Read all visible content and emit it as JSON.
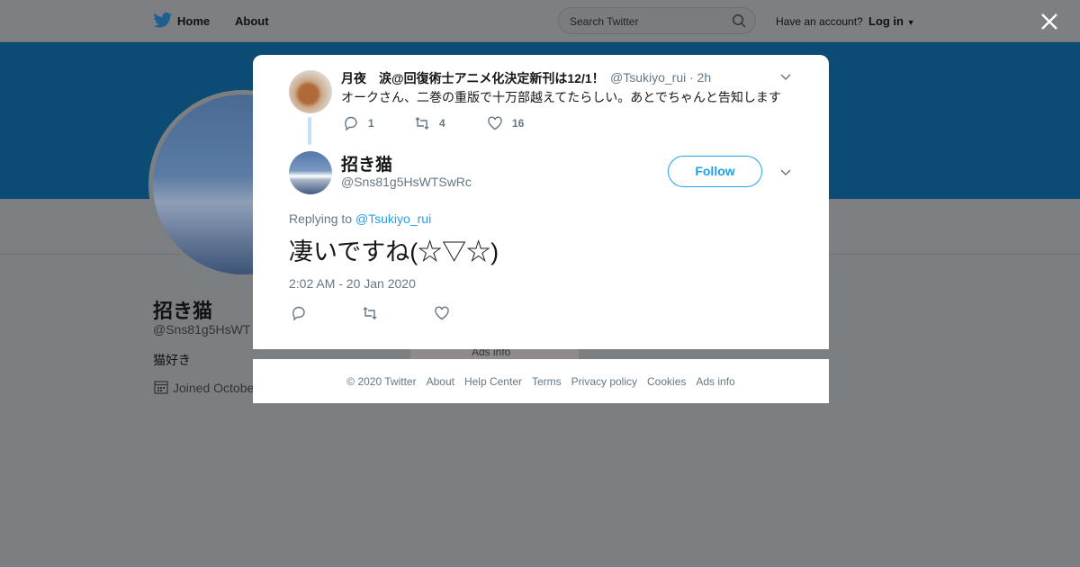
{
  "colors": {
    "accent": "#1da1f2",
    "banner": "#0c4b74",
    "overlay": "#7c7f82"
  },
  "topbar": {
    "nav_home": "Home",
    "nav_about": "About",
    "search_placeholder": "Search Twitter",
    "have_account": "Have an account?",
    "login": "Log in"
  },
  "profile": {
    "name": "招き猫",
    "handle": "@Sns81g5HsWT",
    "bio": "猫好き",
    "joined": "Joined Octobe",
    "ads_info": "Ads info"
  },
  "parent_tweet": {
    "name": "月夜　涙@回復術士アニメ化決定新刊は12/1！",
    "handle": "@Tsukiyo_rui",
    "time": "· 2h",
    "text": "オークさん、二巻の重版で十万部越えてたらしい。あとでちゃんと告知します",
    "replies": "1",
    "retweets": "4",
    "likes": "16"
  },
  "main_tweet": {
    "name": "招き猫",
    "handle": "@Sns81g5HsWTSwRc",
    "follow_label": "Follow",
    "replying_prefix": "Replying to",
    "replying_to": "@Tsukiyo_rui",
    "text": "凄いですね(☆▽☆)",
    "timestamp": "2:02 AM - 20 Jan 2020"
  },
  "footer": {
    "items": [
      "© 2020 Twitter",
      "About",
      "Help Center",
      "Terms",
      "Privacy policy",
      "Cookies",
      "Ads info"
    ]
  }
}
